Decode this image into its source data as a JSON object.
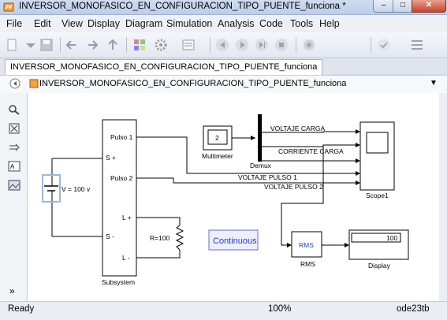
{
  "window": {
    "title": "INVERSOR_MONOFASICO_EN_CONFIGURACION_TIPO_PUENTE_funciona *"
  },
  "menu": [
    "File",
    "Edit",
    "View",
    "Display",
    "Diagram",
    "Simulation",
    "Analysis",
    "Code",
    "Tools",
    "Help"
  ],
  "tab": {
    "label": "INVERSOR_MONOFASICO_EN_CONFIGURACION_TIPO_PUENTE_funciona"
  },
  "breadcrumb": {
    "path": "INVERSOR_MONOFASICO_EN_CONFIGURACION_TIPO_PUENTE_funciona"
  },
  "blocks": {
    "source": {
      "label": "V = 100 v"
    },
    "subsystem": {
      "name": "Subsystem",
      "ports": {
        "pulso1": "Pulso 1",
        "pulso2": "Pulso 2",
        "s_plus": "S +",
        "s_minus": "S -",
        "l_plus": "L +",
        "l_minus": "L -"
      }
    },
    "resistor": {
      "label": "R=100"
    },
    "multimeter": {
      "value": "2",
      "name": "Multimeter"
    },
    "demux": {
      "name": "Demux"
    },
    "scope": {
      "name": "Scope1"
    },
    "continuous": {
      "label": "Continuous"
    },
    "rms": {
      "inner": "RMS",
      "name": "RMS"
    },
    "display": {
      "value": "100",
      "name": "Display"
    }
  },
  "signals": {
    "voltaje_carga": "VOLTAJE CARGA",
    "corriente_carga": "CORRIENTE CARGA",
    "voltaje_pulso1": "VOLTAJE PULSO 1",
    "voltaje_pulso2": "VOLTAJE PULSO 2"
  },
  "status": {
    "state": "Ready",
    "zoom": "100%",
    "solver": "ode23tb"
  },
  "colors": {
    "accent": "#1f3fbf",
    "titlebar": "#bccde8",
    "close": "#c7432b"
  }
}
